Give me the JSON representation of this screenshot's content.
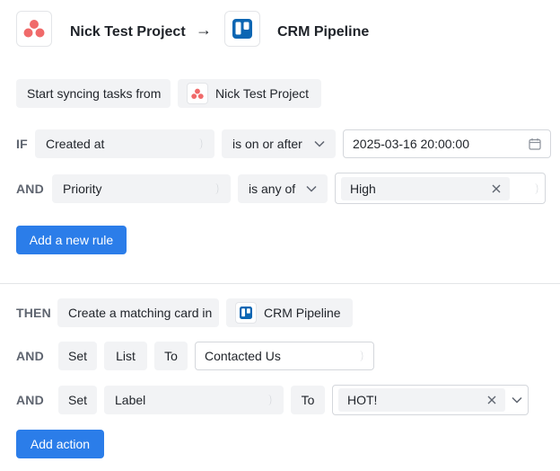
{
  "header": {
    "source_title": "Nick Test Project",
    "arrow": "→",
    "target_title": "CRM Pipeline"
  },
  "sync": {
    "label": "Start syncing tasks from",
    "project": "Nick Test Project"
  },
  "rules": [
    {
      "keyword": "IF",
      "field": "Created at",
      "operator": "is on or after",
      "value": "2025-03-16 20:00:00"
    },
    {
      "keyword": "AND",
      "field": "Priority",
      "operator": "is any of",
      "value": "High"
    }
  ],
  "add_rule_label": "Add a new rule",
  "actions": {
    "then_keyword": "THEN",
    "create_label": "Create a matching card in",
    "board": "CRM Pipeline",
    "rows": [
      {
        "keyword": "AND",
        "set": "Set",
        "field": "List",
        "to": "To",
        "value": "Contacted Us"
      },
      {
        "keyword": "AND",
        "set": "Set",
        "field": "Label",
        "to": "To",
        "value": "HOT!"
      }
    ]
  },
  "add_action_label": "Add action",
  "colors": {
    "asana": "#f06a6a",
    "trello": "#0c66b3",
    "primary": "#2b7de9"
  }
}
